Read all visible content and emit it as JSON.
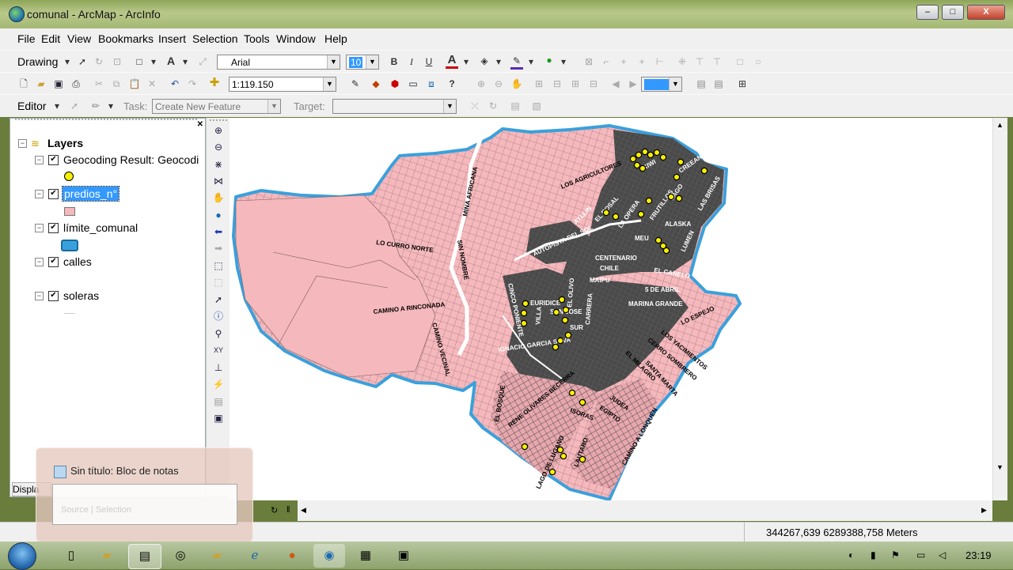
{
  "window": {
    "title": "comunal - ArcMap - ArcInfo",
    "minimize": "–",
    "maximize": "□",
    "close": "X"
  },
  "menu": [
    "File",
    "Edit",
    "View",
    "Bookmarks",
    "Insert",
    "Selection",
    "Tools",
    "Window",
    "Help"
  ],
  "drawing_toolbar": {
    "label": "Drawing",
    "font": "Arial",
    "font_size": "10",
    "bold": "B",
    "italic": "I",
    "underline": "U"
  },
  "standard_toolbar": {
    "scale": "1:119.150",
    "zoom": "100%"
  },
  "editor_toolbar": {
    "label": "Editor",
    "task_label": "Task:",
    "task_value": "Create New Feature",
    "target_label": "Target:"
  },
  "toc": {
    "root": "Layers",
    "layers": [
      {
        "name": "Geocoding Result: Geocodi",
        "checked": true,
        "selected": false
      },
      {
        "name": "predios_n°",
        "checked": true,
        "selected": true
      },
      {
        "name": "límite_comunal",
        "checked": true,
        "selected": false
      },
      {
        "name": "calles",
        "checked": true,
        "selected": false
      },
      {
        "name": "soleras",
        "checked": true,
        "selected": false
      }
    ],
    "bottom_tab": "Displa",
    "bottom_tab_mid": "Source | Selection"
  },
  "map_labels": [
    "MINA AFRICANA",
    "SIN NOMBRE",
    "LOS AGRICULTORES",
    "KIWI",
    "CREEANS",
    "LAS BRISAS",
    "LAGO",
    "FRUTILLOS",
    "EL ROSAL",
    "LA OPERA",
    "ALASKA",
    "LUMEN",
    "AYLLIN",
    "AUTOPISTA DEL SOL",
    "LO CURRO NORTE",
    "MEU",
    "CENTENARIO",
    "CHILE",
    "EL CANELO",
    "MAIPU",
    "5 DE ABRIL",
    "MARINA GRANDE",
    "CAMINO A RINCONADA",
    "CINCO PONIENTE",
    "EURIDICE",
    "SAN JOSE",
    "SUR",
    "LO ESPEJO",
    "LOS YACIMIENTOS",
    "CERRO SOMBRERO",
    "IGNACIO GARCIA SILVA",
    "EL MILAGRO",
    "SANTA MARTA",
    "CAMINO VECINAL",
    "EL BOSQUE",
    "RENE OLIVARES BECERRA",
    "ISORAS",
    "EGIPTO",
    "JUDEA",
    "LAGO DE LUGANO",
    "LAUTARO",
    "CAMINO A LONQUEN",
    "VILLA",
    "CARRERA",
    "EL OLIVO"
  ],
  "status": {
    "coordinates": "344267,639  6289388,758 Meters"
  },
  "notepad": {
    "title": "Sin título: Bloc de notas"
  },
  "taskbar": {
    "time": "23:19"
  },
  "colors": {
    "parcels_fill": "#f5b8bc",
    "urban_dark": "#4d4d4d",
    "boundary": "#3aa0dc",
    "geocode_point": "#f7f000",
    "selection": "#3399ff"
  }
}
